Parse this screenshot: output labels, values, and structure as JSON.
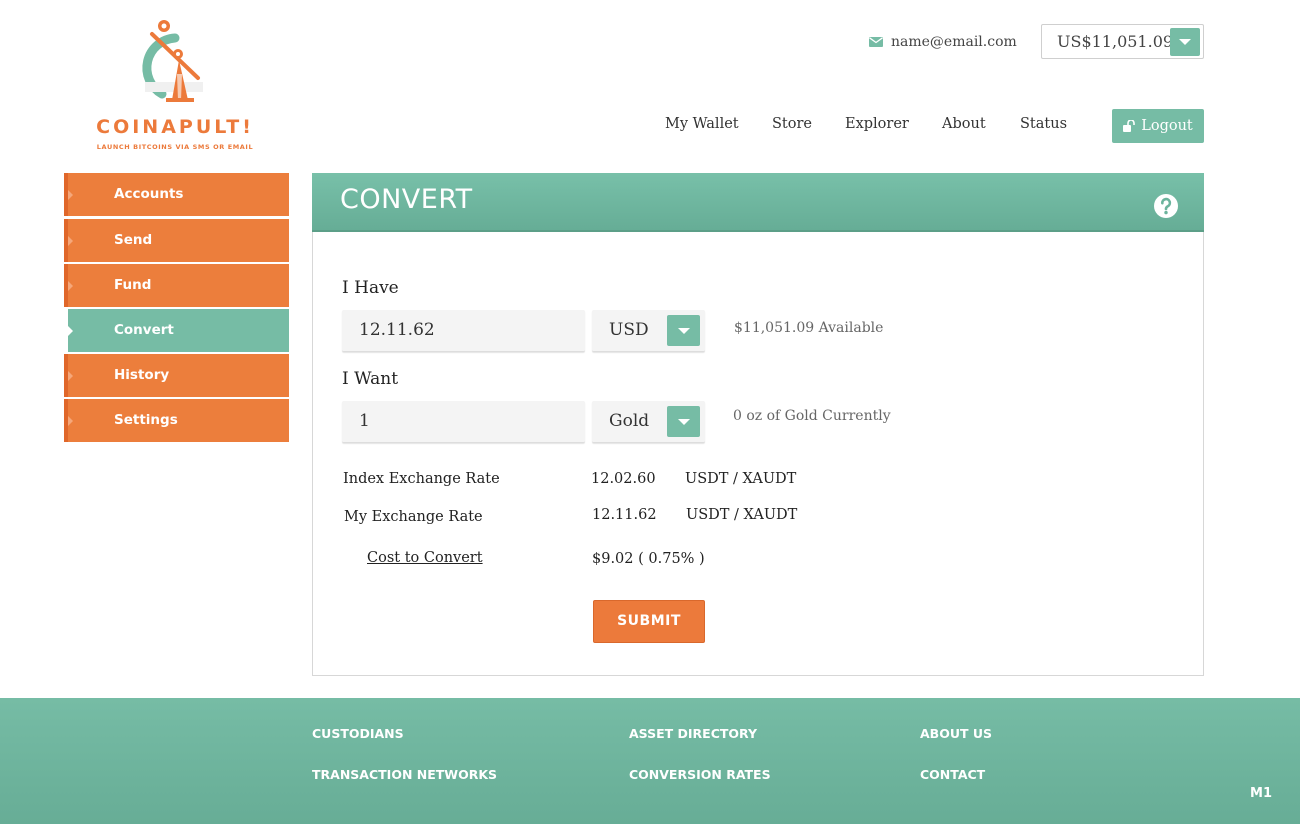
{
  "brand": {
    "name": "COINAPULT!",
    "tagline": "LAUNCH BITCOINS VIA SMS OR EMAIL",
    "logo_icon": "catapult-bitcoin-logo",
    "accent_color": "#ec7a3b",
    "secondary_color": "#76bca5"
  },
  "header": {
    "email": "name@email.com",
    "email_icon": "envelope-icon",
    "balance": "US$11,051.09",
    "nav": [
      "My Wallet",
      "Store",
      "Explorer",
      "About",
      "Status"
    ],
    "logout_label": "Logout",
    "logout_icon": "unlock-icon"
  },
  "sidebar": {
    "items": [
      {
        "label": "Accounts",
        "active": false
      },
      {
        "label": "Send",
        "active": false
      },
      {
        "label": "Fund",
        "active": false
      },
      {
        "label": "Convert",
        "active": true
      },
      {
        "label": "History",
        "active": false
      },
      {
        "label": "Settings",
        "active": false
      }
    ]
  },
  "convert": {
    "title": "CONVERT",
    "help_icon": "question-circle-icon",
    "have": {
      "label": "I Have",
      "amount": "12.11.62",
      "currency": "USD",
      "note": "$11,051.09 Available"
    },
    "want": {
      "label": "I Want",
      "amount": "1",
      "currency": "Gold",
      "note": "0 oz of Gold Currently"
    },
    "rates": [
      {
        "label": "Index Exchange Rate",
        "value": "12.02.60",
        "unit": "USDT / XAUDT"
      },
      {
        "label": "My Exchange Rate",
        "value": "12.11.62",
        "unit": "USDT / XAUDT"
      }
    ],
    "cost": {
      "label": "Cost to Convert",
      "value": "$9.02 ( 0.75% )"
    },
    "submit_label": "SUBMIT"
  },
  "footer": {
    "columns": [
      [
        "CUSTODIANS",
        "TRANSACTION NETWORKS"
      ],
      [
        "ASSET DIRECTORY",
        "CONVERSION RATES"
      ],
      [
        "ABOUT US",
        "CONTACT"
      ]
    ],
    "mark": "M1"
  }
}
